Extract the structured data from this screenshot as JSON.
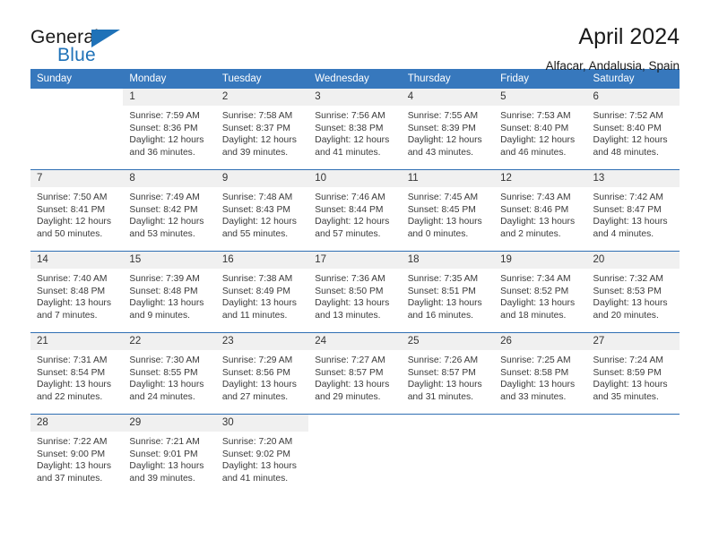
{
  "brand": {
    "name_part1": "General",
    "name_part2": "Blue",
    "logo_icon": "triangle-logo-icon"
  },
  "header": {
    "title": "April 2024",
    "location": "Alfacar, Andalusia, Spain"
  },
  "calendar": {
    "weekday_headers": [
      "Sunday",
      "Monday",
      "Tuesday",
      "Wednesday",
      "Thursday",
      "Friday",
      "Saturday"
    ],
    "accent_color": "#3778bd",
    "border_color": "#2f6fb3",
    "daynum_background": "#f0f0f0",
    "weeks": [
      [
        {
          "day": "",
          "sunrise": "",
          "sunset": "",
          "daylight_line1": "",
          "daylight_line2": ""
        },
        {
          "day": "1",
          "sunrise": "Sunrise: 7:59 AM",
          "sunset": "Sunset: 8:36 PM",
          "daylight_line1": "Daylight: 12 hours",
          "daylight_line2": "and 36 minutes."
        },
        {
          "day": "2",
          "sunrise": "Sunrise: 7:58 AM",
          "sunset": "Sunset: 8:37 PM",
          "daylight_line1": "Daylight: 12 hours",
          "daylight_line2": "and 39 minutes."
        },
        {
          "day": "3",
          "sunrise": "Sunrise: 7:56 AM",
          "sunset": "Sunset: 8:38 PM",
          "daylight_line1": "Daylight: 12 hours",
          "daylight_line2": "and 41 minutes."
        },
        {
          "day": "4",
          "sunrise": "Sunrise: 7:55 AM",
          "sunset": "Sunset: 8:39 PM",
          "daylight_line1": "Daylight: 12 hours",
          "daylight_line2": "and 43 minutes."
        },
        {
          "day": "5",
          "sunrise": "Sunrise: 7:53 AM",
          "sunset": "Sunset: 8:40 PM",
          "daylight_line1": "Daylight: 12 hours",
          "daylight_line2": "and 46 minutes."
        },
        {
          "day": "6",
          "sunrise": "Sunrise: 7:52 AM",
          "sunset": "Sunset: 8:40 PM",
          "daylight_line1": "Daylight: 12 hours",
          "daylight_line2": "and 48 minutes."
        }
      ],
      [
        {
          "day": "7",
          "sunrise": "Sunrise: 7:50 AM",
          "sunset": "Sunset: 8:41 PM",
          "daylight_line1": "Daylight: 12 hours",
          "daylight_line2": "and 50 minutes."
        },
        {
          "day": "8",
          "sunrise": "Sunrise: 7:49 AM",
          "sunset": "Sunset: 8:42 PM",
          "daylight_line1": "Daylight: 12 hours",
          "daylight_line2": "and 53 minutes."
        },
        {
          "day": "9",
          "sunrise": "Sunrise: 7:48 AM",
          "sunset": "Sunset: 8:43 PM",
          "daylight_line1": "Daylight: 12 hours",
          "daylight_line2": "and 55 minutes."
        },
        {
          "day": "10",
          "sunrise": "Sunrise: 7:46 AM",
          "sunset": "Sunset: 8:44 PM",
          "daylight_line1": "Daylight: 12 hours",
          "daylight_line2": "and 57 minutes."
        },
        {
          "day": "11",
          "sunrise": "Sunrise: 7:45 AM",
          "sunset": "Sunset: 8:45 PM",
          "daylight_line1": "Daylight: 13 hours",
          "daylight_line2": "and 0 minutes."
        },
        {
          "day": "12",
          "sunrise": "Sunrise: 7:43 AM",
          "sunset": "Sunset: 8:46 PM",
          "daylight_line1": "Daylight: 13 hours",
          "daylight_line2": "and 2 minutes."
        },
        {
          "day": "13",
          "sunrise": "Sunrise: 7:42 AM",
          "sunset": "Sunset: 8:47 PM",
          "daylight_line1": "Daylight: 13 hours",
          "daylight_line2": "and 4 minutes."
        }
      ],
      [
        {
          "day": "14",
          "sunrise": "Sunrise: 7:40 AM",
          "sunset": "Sunset: 8:48 PM",
          "daylight_line1": "Daylight: 13 hours",
          "daylight_line2": "and 7 minutes."
        },
        {
          "day": "15",
          "sunrise": "Sunrise: 7:39 AM",
          "sunset": "Sunset: 8:48 PM",
          "daylight_line1": "Daylight: 13 hours",
          "daylight_line2": "and 9 minutes."
        },
        {
          "day": "16",
          "sunrise": "Sunrise: 7:38 AM",
          "sunset": "Sunset: 8:49 PM",
          "daylight_line1": "Daylight: 13 hours",
          "daylight_line2": "and 11 minutes."
        },
        {
          "day": "17",
          "sunrise": "Sunrise: 7:36 AM",
          "sunset": "Sunset: 8:50 PM",
          "daylight_line1": "Daylight: 13 hours",
          "daylight_line2": "and 13 minutes."
        },
        {
          "day": "18",
          "sunrise": "Sunrise: 7:35 AM",
          "sunset": "Sunset: 8:51 PM",
          "daylight_line1": "Daylight: 13 hours",
          "daylight_line2": "and 16 minutes."
        },
        {
          "day": "19",
          "sunrise": "Sunrise: 7:34 AM",
          "sunset": "Sunset: 8:52 PM",
          "daylight_line1": "Daylight: 13 hours",
          "daylight_line2": "and 18 minutes."
        },
        {
          "day": "20",
          "sunrise": "Sunrise: 7:32 AM",
          "sunset": "Sunset: 8:53 PM",
          "daylight_line1": "Daylight: 13 hours",
          "daylight_line2": "and 20 minutes."
        }
      ],
      [
        {
          "day": "21",
          "sunrise": "Sunrise: 7:31 AM",
          "sunset": "Sunset: 8:54 PM",
          "daylight_line1": "Daylight: 13 hours",
          "daylight_line2": "and 22 minutes."
        },
        {
          "day": "22",
          "sunrise": "Sunrise: 7:30 AM",
          "sunset": "Sunset: 8:55 PM",
          "daylight_line1": "Daylight: 13 hours",
          "daylight_line2": "and 24 minutes."
        },
        {
          "day": "23",
          "sunrise": "Sunrise: 7:29 AM",
          "sunset": "Sunset: 8:56 PM",
          "daylight_line1": "Daylight: 13 hours",
          "daylight_line2": "and 27 minutes."
        },
        {
          "day": "24",
          "sunrise": "Sunrise: 7:27 AM",
          "sunset": "Sunset: 8:57 PM",
          "daylight_line1": "Daylight: 13 hours",
          "daylight_line2": "and 29 minutes."
        },
        {
          "day": "25",
          "sunrise": "Sunrise: 7:26 AM",
          "sunset": "Sunset: 8:57 PM",
          "daylight_line1": "Daylight: 13 hours",
          "daylight_line2": "and 31 minutes."
        },
        {
          "day": "26",
          "sunrise": "Sunrise: 7:25 AM",
          "sunset": "Sunset: 8:58 PM",
          "daylight_line1": "Daylight: 13 hours",
          "daylight_line2": "and 33 minutes."
        },
        {
          "day": "27",
          "sunrise": "Sunrise: 7:24 AM",
          "sunset": "Sunset: 8:59 PM",
          "daylight_line1": "Daylight: 13 hours",
          "daylight_line2": "and 35 minutes."
        }
      ],
      [
        {
          "day": "28",
          "sunrise": "Sunrise: 7:22 AM",
          "sunset": "Sunset: 9:00 PM",
          "daylight_line1": "Daylight: 13 hours",
          "daylight_line2": "and 37 minutes."
        },
        {
          "day": "29",
          "sunrise": "Sunrise: 7:21 AM",
          "sunset": "Sunset: 9:01 PM",
          "daylight_line1": "Daylight: 13 hours",
          "daylight_line2": "and 39 minutes."
        },
        {
          "day": "30",
          "sunrise": "Sunrise: 7:20 AM",
          "sunset": "Sunset: 9:02 PM",
          "daylight_line1": "Daylight: 13 hours",
          "daylight_line2": "and 41 minutes."
        },
        {
          "day": "",
          "sunrise": "",
          "sunset": "",
          "daylight_line1": "",
          "daylight_line2": ""
        },
        {
          "day": "",
          "sunrise": "",
          "sunset": "",
          "daylight_line1": "",
          "daylight_line2": ""
        },
        {
          "day": "",
          "sunrise": "",
          "sunset": "",
          "daylight_line1": "",
          "daylight_line2": ""
        },
        {
          "day": "",
          "sunrise": "",
          "sunset": "",
          "daylight_line1": "",
          "daylight_line2": ""
        }
      ]
    ]
  }
}
